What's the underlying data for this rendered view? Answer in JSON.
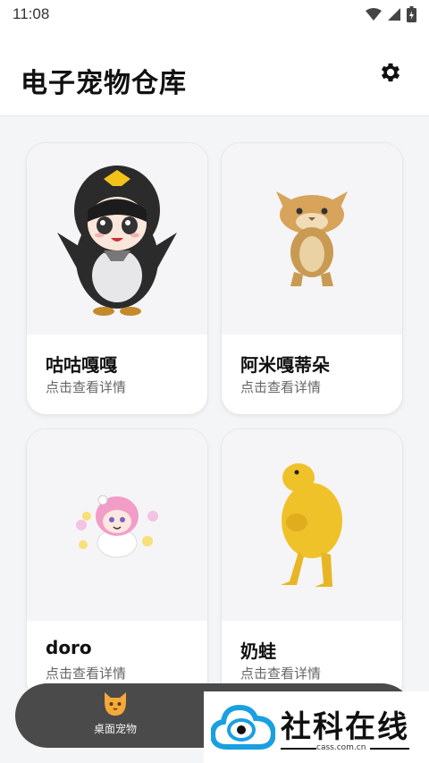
{
  "status_bar": {
    "time": "11:08"
  },
  "header": {
    "title": "电子宠物仓库"
  },
  "pets": [
    {
      "name": "咕咕嘎嘎",
      "subtitle": "点击查看详情"
    },
    {
      "name": "阿米嘎蒂朵",
      "subtitle": "点击查看详情"
    },
    {
      "name": "doro",
      "subtitle": "点击查看详情"
    },
    {
      "name": "奶蛙",
      "subtitle": "点击查看详情"
    }
  ],
  "bottom_nav": {
    "items": [
      {
        "label": "桌面宠物",
        "icon": "cat-icon"
      }
    ]
  },
  "watermark": {
    "brand": "社科在线",
    "url": "cass.com.cn"
  },
  "colors": {
    "nav_bg": "#4a4a4a",
    "card_bg": "#ffffff",
    "page_bg": "#f4f5f7",
    "accent_blue": "#1aa0e0"
  }
}
